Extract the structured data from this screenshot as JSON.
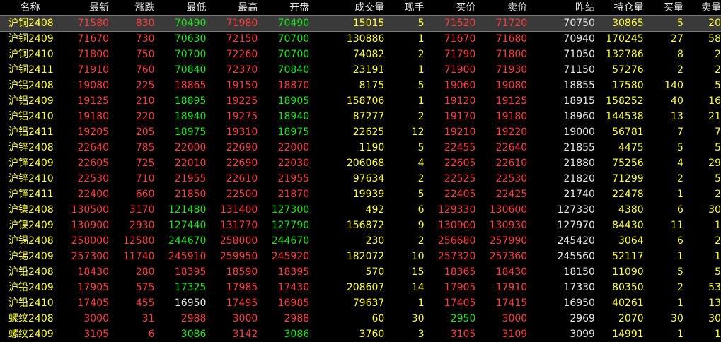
{
  "columns": [
    "名称",
    "最新",
    "涨跌",
    "最低",
    "最高",
    "开盘",
    "成交量",
    "现手",
    "买价",
    "卖价",
    "昨结",
    "持仓量",
    "买量",
    "卖量"
  ],
  "rows": [
    [
      "沪铜2408",
      "71580",
      "830",
      "70490",
      "71980",
      "70490",
      "15015",
      "5",
      "71520",
      "71720",
      "70750",
      "30865",
      "5",
      "20"
    ],
    [
      "沪铜2409",
      "71670",
      "730",
      "70630",
      "72150",
      "70700",
      "130886",
      "1",
      "71670",
      "71680",
      "70940",
      "170245",
      "27",
      "58"
    ],
    [
      "沪铜2410",
      "71800",
      "750",
      "70700",
      "72260",
      "70700",
      "74082",
      "2",
      "71790",
      "71800",
      "71050",
      "132786",
      "8",
      "2"
    ],
    [
      "沪铜2411",
      "71910",
      "760",
      "70840",
      "72370",
      "70840",
      "23191",
      "1",
      "71900",
      "71930",
      "71150",
      "57276",
      "2",
      "2"
    ],
    [
      "沪铝2408",
      "19080",
      "225",
      "18865",
      "19150",
      "18870",
      "8175",
      "5",
      "19060",
      "19080",
      "18855",
      "17580",
      "140",
      "5"
    ],
    [
      "沪铝2409",
      "19125",
      "210",
      "18895",
      "19225",
      "18905",
      "158706",
      "1",
      "19120",
      "19125",
      "18915",
      "158252",
      "40",
      "16"
    ],
    [
      "沪铝2410",
      "19180",
      "220",
      "18940",
      "19275",
      "18940",
      "87277",
      "2",
      "19170",
      "19180",
      "18960",
      "144538",
      "13",
      "21"
    ],
    [
      "沪铝2411",
      "19205",
      "205",
      "18975",
      "19310",
      "18975",
      "22625",
      "12",
      "19210",
      "19220",
      "19000",
      "56781",
      "7",
      "7"
    ],
    [
      "沪锌2408",
      "22640",
      "785",
      "22000",
      "22690",
      "22000",
      "1190",
      "5",
      "22455",
      "22640",
      "21855",
      "4475",
      "5",
      "5"
    ],
    [
      "沪锌2409",
      "22605",
      "725",
      "22010",
      "22690",
      "22030",
      "206068",
      "4",
      "22605",
      "22610",
      "21880",
      "75256",
      "4",
      "29"
    ],
    [
      "沪锌2410",
      "22530",
      "710",
      "21955",
      "22610",
      "21955",
      "97634",
      "2",
      "22525",
      "22530",
      "21820",
      "71299",
      "2",
      "5"
    ],
    [
      "沪锌2411",
      "22400",
      "660",
      "21850",
      "22500",
      "21870",
      "19939",
      "5",
      "22405",
      "22425",
      "21740",
      "22478",
      "1",
      "2"
    ],
    [
      "沪镍2408",
      "130500",
      "3170",
      "121480",
      "131400",
      "127300",
      "492",
      "6",
      "129330",
      "130600",
      "127330",
      "4380",
      "6",
      "30"
    ],
    [
      "沪镍2409",
      "130900",
      "2930",
      "127440",
      "131770",
      "127790",
      "156872",
      "9",
      "130900",
      "130930",
      "127970",
      "84430",
      "11",
      "1"
    ],
    [
      "沪锡2408",
      "258000",
      "12580",
      "244670",
      "258000",
      "244670",
      "230",
      "2",
      "256680",
      "257990",
      "245420",
      "3064",
      "6",
      "2"
    ],
    [
      "沪锡2409",
      "257300",
      "11740",
      "245910",
      "259950",
      "245920",
      "182072",
      "10",
      "257320",
      "257360",
      "245560",
      "52117",
      "1",
      "1"
    ],
    [
      "沪铅2408",
      "18430",
      "280",
      "18395",
      "18590",
      "18395",
      "570",
      "15",
      "18365",
      "18430",
      "18150",
      "11090",
      "5",
      "5"
    ],
    [
      "沪铅2409",
      "17905",
      "575",
      "17325",
      "17985",
      "17430",
      "208607",
      "14",
      "17905",
      "17910",
      "17330",
      "80350",
      "2",
      "53"
    ],
    [
      "沪铅2410",
      "17405",
      "455",
      "16950",
      "17495",
      "16985",
      "79637",
      "1",
      "17405",
      "17415",
      "16950",
      "40261",
      "1",
      "13"
    ],
    [
      "螺纹2408",
      "3000",
      "31",
      "2988",
      "3000",
      "2988",
      "60",
      "30",
      "2950",
      "3000",
      "2969",
      "2070",
      "30",
      "30"
    ],
    [
      "螺纹2409",
      "3105",
      "6",
      "3086",
      "3142",
      "3086",
      "3760",
      "3",
      "3105",
      "3109",
      "3099",
      "14991",
      "1",
      "1"
    ]
  ],
  "colors": {
    "up": "#ff3b3b",
    "down": "#19e619",
    "flat": "#e6e6e6",
    "volume": "#ffff33",
    "header": "#e6e6e6"
  }
}
